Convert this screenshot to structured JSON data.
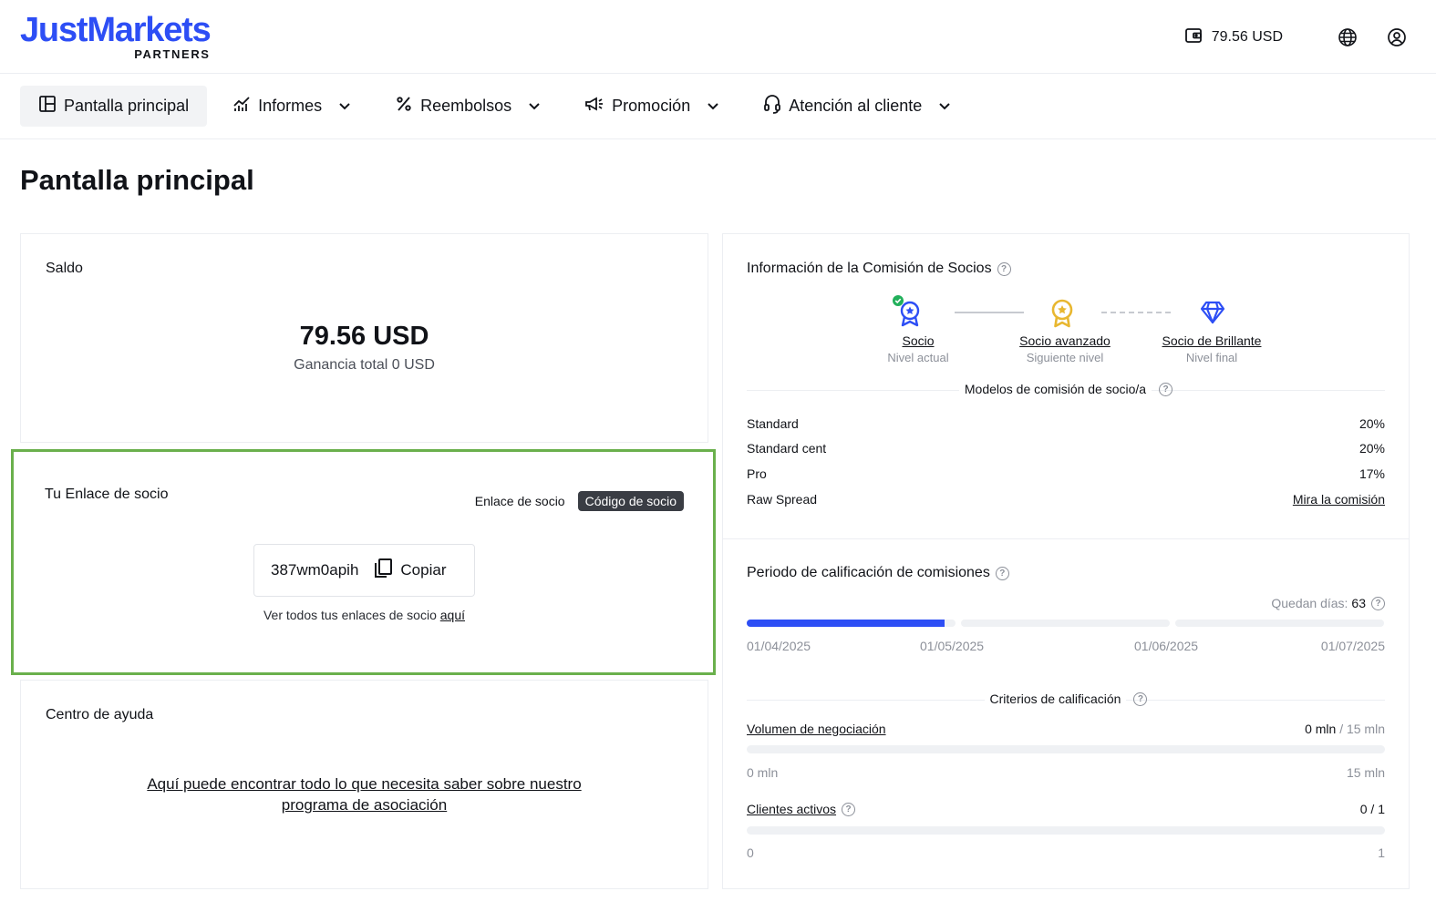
{
  "header": {
    "logo_main": "JustMarkets",
    "logo_sub": "PARTNERS",
    "balance": "79.56 USD",
    "icons": [
      "wallet-icon",
      "globe-icon",
      "user-icon"
    ]
  },
  "nav": {
    "items": [
      {
        "label": "Pantalla principal",
        "icon": "dashboard-icon",
        "active": true
      },
      {
        "label": "Informes",
        "icon": "chart-icon"
      },
      {
        "label": "Reembolsos",
        "icon": "percent-icon"
      },
      {
        "label": "Promoción",
        "icon": "megaphone-icon"
      },
      {
        "label": "Atención al cliente",
        "icon": "headset-icon"
      }
    ]
  },
  "page": {
    "title": "Pantalla principal"
  },
  "saldo": {
    "title": "Saldo",
    "amount": "79.56 USD",
    "sub": "Ganancia total 0 USD"
  },
  "link_card": {
    "title": "Tu Enlace de socio",
    "tab_link": "Enlace de socio",
    "tab_code": "Código de socio",
    "code": "387wm0apih",
    "copy": "Copiar",
    "all_links_text": "Ver todos tus enlaces de socio",
    "all_links_anchor": "aquí"
  },
  "help": {
    "title": "Centro de ayuda",
    "line1": "Aquí puede encontrar todo lo que necesita saber sobre nuestro",
    "line2": "programa de asociación"
  },
  "commission": {
    "title": "Información de la Comisión de Socios",
    "levels": [
      {
        "name": "Socio",
        "sub": "Nivel actual"
      },
      {
        "name": "Socio avanzado",
        "sub": "Siguiente nivel"
      },
      {
        "name": "Socio de Brillante",
        "sub": "Nivel final"
      }
    ],
    "models_title": "Modelos de comisión de socio/a",
    "models": [
      {
        "name": "Standard",
        "value": "20%"
      },
      {
        "name": "Standard cent",
        "value": "20%"
      },
      {
        "name": "Pro",
        "value": "17%"
      },
      {
        "name": "Raw Spread",
        "value": "Mira la comisión"
      }
    ]
  },
  "period": {
    "title": "Periodo de calificación de comisiones",
    "days_label": "Quedan días:",
    "days_value": "63",
    "progress": 0.31,
    "dates": [
      "01/04/2025",
      "01/05/2025",
      "01/06/2025",
      "01/07/2025"
    ],
    "criteria_title": "Criterios de calificación",
    "volume": {
      "label": "Volumen de negociación",
      "current": "0 mln",
      "target": "/ 15 mln",
      "min": "0 mln",
      "max": "15 mln"
    },
    "clients": {
      "label": "Clientes activos",
      "current": "0",
      "target": "/ 1",
      "min": "0",
      "max": "1"
    }
  },
  "colors": {
    "brand": "#2d4ef5",
    "highlight": "#6ab04c",
    "gold": "#e8b730",
    "success": "#22b05b"
  }
}
